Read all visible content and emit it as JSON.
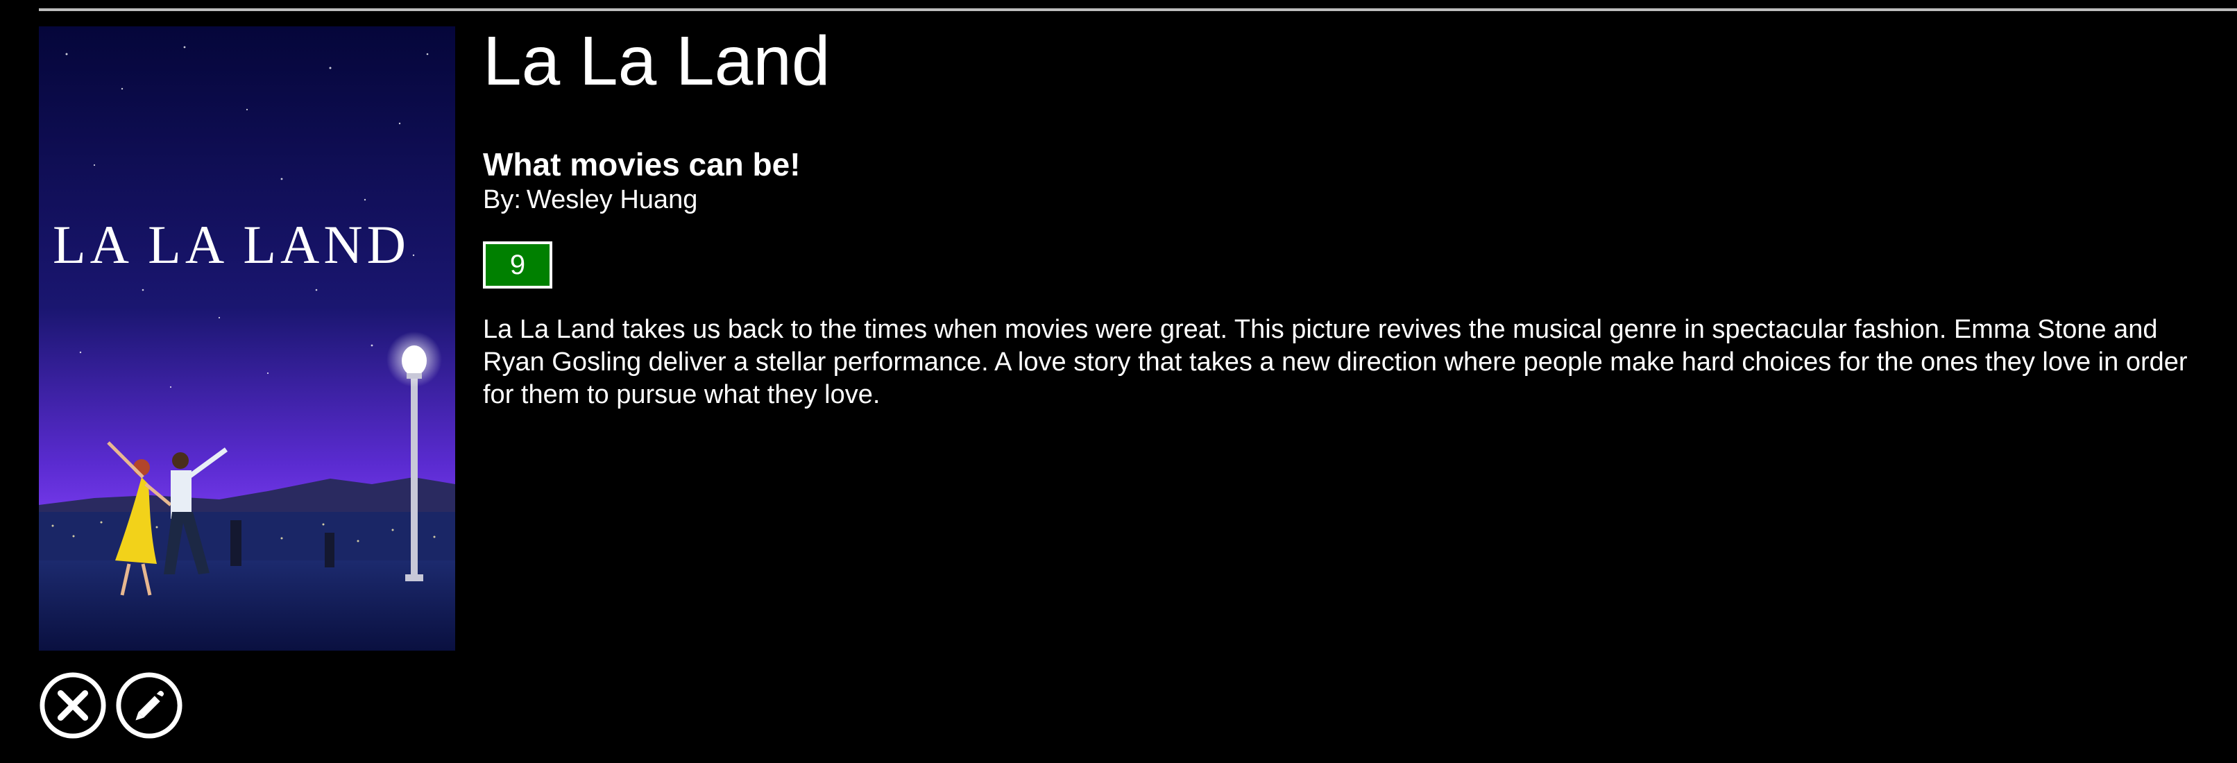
{
  "movie": {
    "title": "La La Land",
    "tagline": "What movies can be!",
    "author_prefix": "By:",
    "author": "Wesley Huang",
    "score": "9",
    "review": "La La Land takes us back to the times when movies were great. This picture revives the musical genre in spectacular fashion. Emma Stone and Ryan Gosling deliver a stellar performance. A love story that takes a new direction where people make hard choices for the ones they love in order for them to pursue what they love."
  },
  "poster": {
    "overlay_text": "LA LA LAND"
  },
  "actions": {
    "delete_icon": "close-circle-icon",
    "edit_icon": "pencil-circle-icon"
  },
  "colors": {
    "background": "#000000",
    "score_badge": "#008000",
    "rule": "#bdbdbd",
    "text": "#ffffff"
  }
}
